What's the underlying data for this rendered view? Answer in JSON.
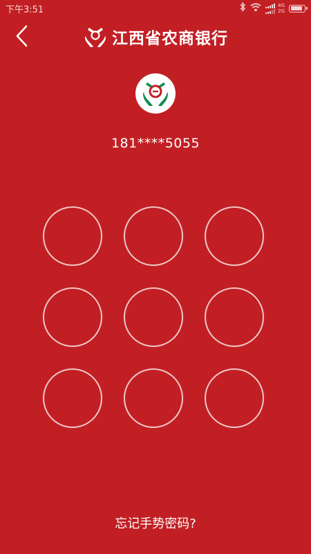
{
  "status_bar": {
    "time": "下午3:51",
    "network_4g": "4G",
    "network_2g": "2G",
    "battery_level": 0.9,
    "icons": [
      "bluetooth-icon",
      "wifi-icon",
      "signal-icon",
      "battery-icon"
    ]
  },
  "header": {
    "title": "江西省农商银行",
    "back_icon": "chevron-left-icon",
    "logo_icon": "bank-logo-icon"
  },
  "user": {
    "avatar_icon": "bank-logo-icon",
    "account": "181****5055"
  },
  "gesture": {
    "node_count": 9
  },
  "footer": {
    "forgot_label": "忘记手势密码?"
  },
  "colors": {
    "background": "#c21f24",
    "logo_green": "#0f8c53",
    "ring": "#f0c8c8"
  }
}
